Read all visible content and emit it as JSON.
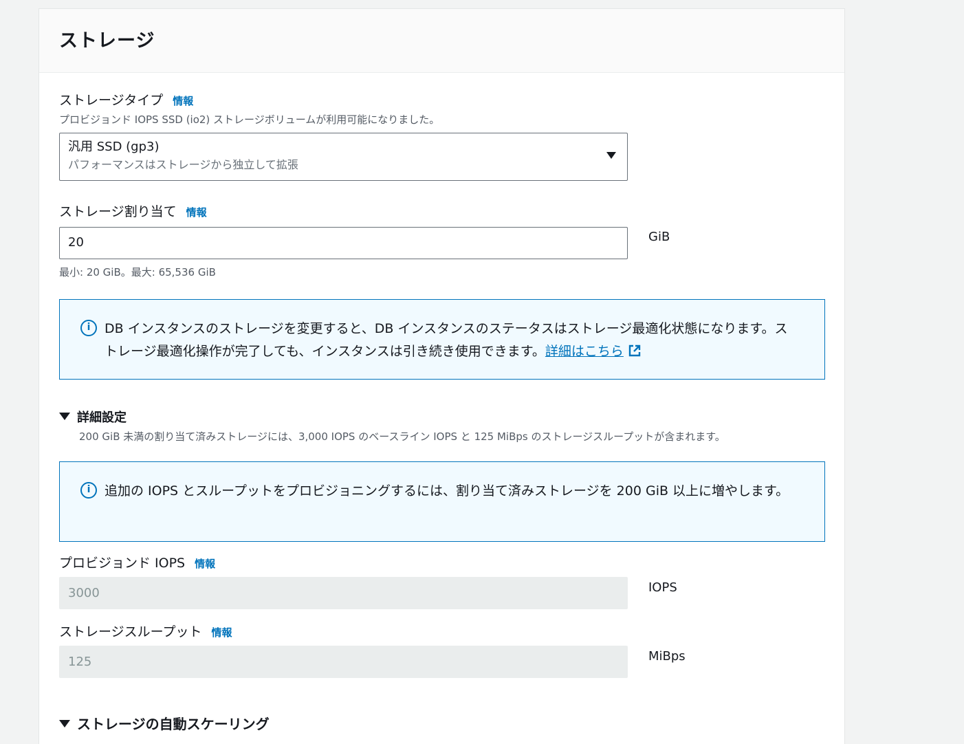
{
  "panel": {
    "title": "ストレージ"
  },
  "storage_type": {
    "label": "ストレージタイプ",
    "info": "情報",
    "description": "プロビジョンド IOPS SSD (io2) ストレージボリュームが利用可能になりました。",
    "selected_value": "汎用 SSD (gp3)",
    "selected_sub": "パフォーマンスはストレージから独立して拡張"
  },
  "allocation": {
    "label": "ストレージ割り当て",
    "info": "情報",
    "value": "20",
    "unit": "GiB",
    "hint": "最小: 20 GiB。最大: 65,536 GiB"
  },
  "alert1": {
    "text": "DB インスタンスのストレージを変更すると、DB インスタンスのステータスはストレージ最適化状態になります。ストレージ最適化操作が完了しても、インスタンスは引き続き使用できます。",
    "link": "詳細はこちら"
  },
  "advanced": {
    "label": "詳細設定",
    "description": "200 GiB 未満の割り当て済みストレージには、3,000 IOPS のベースライン IOPS と 125 MiBps のストレージスループットが含まれます。"
  },
  "alert2": {
    "text": "追加の IOPS とスループットをプロビジョニングするには、割り当て済みストレージを 200 GiB 以上に増やします。"
  },
  "iops": {
    "label": "プロビジョンド IOPS",
    "info": "情報",
    "value": "3000",
    "unit": "IOPS"
  },
  "throughput": {
    "label": "ストレージスループット",
    "info": "情報",
    "value": "125",
    "unit": "MiBps"
  },
  "autoscaling": {
    "label": "ストレージの自動スケーリング"
  },
  "colors": {
    "link": "#0073bb",
    "alert_bg": "#f1faff",
    "disabled_bg": "#eaeded"
  }
}
